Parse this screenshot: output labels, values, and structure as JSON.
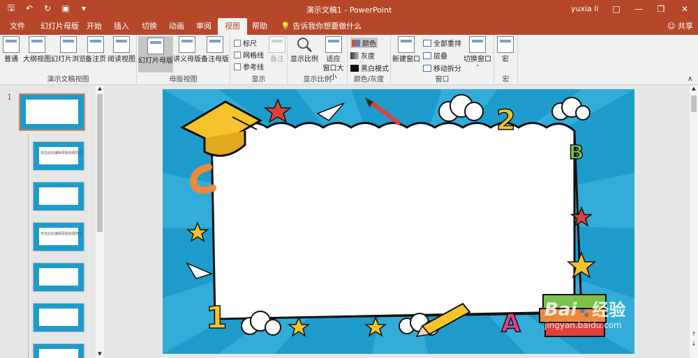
{
  "window": {
    "title": "演示文稿1 - PowerPoint",
    "user": "yuxia li",
    "share_label": "共享"
  },
  "tabs": [
    {
      "label": "文件"
    },
    {
      "label": "幻灯片母版"
    },
    {
      "label": "开始"
    },
    {
      "label": "插入"
    },
    {
      "label": "切换"
    },
    {
      "label": "动画"
    },
    {
      "label": "审阅"
    },
    {
      "label": "视图",
      "active": true
    },
    {
      "label": "帮助"
    }
  ],
  "tell_me": "告诉我你想要做什么",
  "ribbon": {
    "groups": {
      "presentation_views": "演示文稿视图",
      "master_views": "母版视图",
      "show": "显示",
      "zoom": "显示比例",
      "color": "颜色/灰度",
      "window": "窗口",
      "macros": "宏"
    },
    "buttons": {
      "normal": "普通",
      "outline": "大纲视图",
      "sorter": "幻灯片浏览",
      "notes_page": "备注页",
      "reading": "阅读视图",
      "slide_master": "幻灯片母版",
      "handout_master": "讲义母版",
      "notes_master": "备注母版",
      "ruler": "标尺",
      "gridlines": "网格线",
      "guides": "参考线",
      "notes": "备注",
      "zoom": "显示比例",
      "fit_window_1": "适应",
      "fit_window_2": "窗口大小",
      "color": "颜色",
      "grayscale": "灰度",
      "bw": "黑白模式",
      "new_window": "新建窗口",
      "arrange_all": "全部重排",
      "cascade": "层叠",
      "move_split": "移动拆分",
      "switch_windows": "切换窗口",
      "macros": "宏"
    }
  },
  "slides_panel": {
    "first_number": "1",
    "thumb_texts": [
      "单击此处编辑母版标题样式",
      "",
      "单击此处编辑母版标题样式",
      "",
      ""
    ]
  },
  "slide": {
    "doodles": {
      "num1": "1",
      "num2": "2",
      "letter_a": "A",
      "letter_b": "B",
      "letter_c": "C"
    }
  },
  "watermark": {
    "brand": "Bai",
    "cn": "经验",
    "url": "jingyan.baidu.com"
  },
  "colors": {
    "accent": "#b7472a",
    "slide_bg": "#1d9ccc"
  }
}
